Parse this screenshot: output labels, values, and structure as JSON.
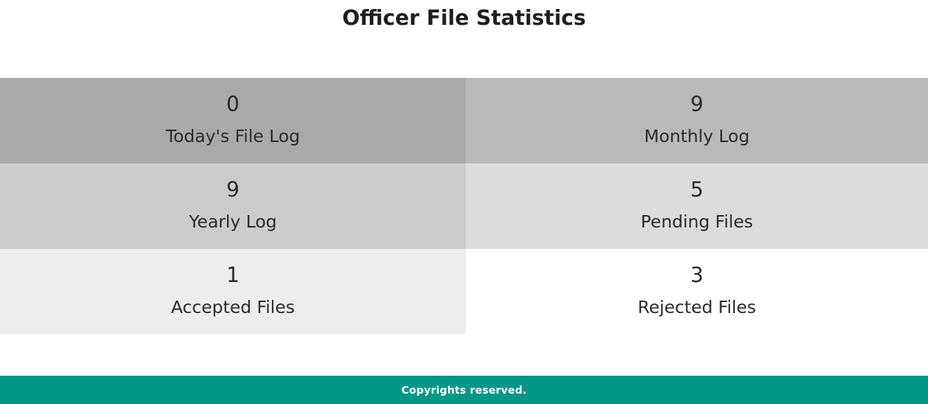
{
  "page": {
    "title": "Officer File Statistics"
  },
  "stats": [
    {
      "value": "0",
      "label": "Today's File Log",
      "color": "#a9a9a9"
    },
    {
      "value": "9",
      "label": "Monthly Log",
      "color": "#b9b9b9"
    },
    {
      "value": "9",
      "label": "Yearly Log",
      "color": "#cbcbcb"
    },
    {
      "value": "5",
      "label": "Pending Files",
      "color": "#dcdcdc"
    },
    {
      "value": "1",
      "label": "Accepted Files",
      "color": "#ededed"
    },
    {
      "value": "3",
      "label": "Rejected Files",
      "color": "#ffffff"
    }
  ],
  "footer": {
    "text": "Copyrights reserved.",
    "color": "#009688"
  }
}
